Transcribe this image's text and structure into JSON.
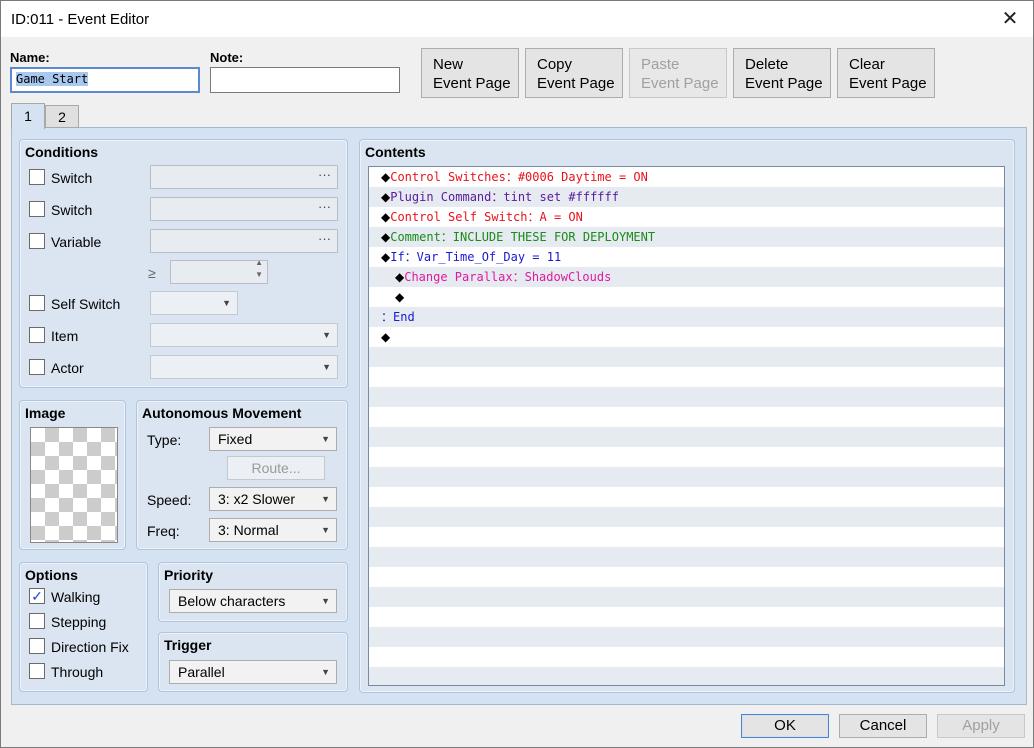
{
  "window": {
    "title": "ID:011 - Event Editor",
    "close_glyph": "✕"
  },
  "header": {
    "name_label": "Name:",
    "name_value": "Game Start",
    "note_label": "Note:",
    "note_value": "",
    "buttons": [
      {
        "line1": "New",
        "line2": "Event Page"
      },
      {
        "line1": "Copy",
        "line2": "Event Page"
      },
      {
        "line1": "Paste",
        "line2": "Event Page"
      },
      {
        "line1": "Delete",
        "line2": "Event Page"
      },
      {
        "line1": "Clear",
        "line2": "Event Page"
      }
    ]
  },
  "tabs": [
    "1",
    "2"
  ],
  "conditions": {
    "title": "Conditions",
    "switch1": "Switch",
    "switch2": "Switch",
    "variable": "Variable",
    "gte": "≥",
    "self_switch": "Self Switch",
    "item": "Item",
    "actor": "Actor",
    "dots": "···"
  },
  "image": {
    "title": "Image"
  },
  "movement": {
    "title": "Autonomous Movement",
    "type_label": "Type:",
    "type_value": "Fixed",
    "route_label": "Route...",
    "speed_label": "Speed:",
    "speed_value": "3: x2 Slower",
    "freq_label": "Freq:",
    "freq_value": "3: Normal"
  },
  "options": {
    "title": "Options",
    "check_glyph": "✓",
    "walking": "Walking",
    "stepping": "Stepping",
    "direction_fix": "Direction Fix",
    "through": "Through"
  },
  "priority": {
    "title": "Priority",
    "value": "Below characters"
  },
  "trigger": {
    "title": "Trigger",
    "value": "Parallel"
  },
  "contents": {
    "title": "Contents",
    "lines": [
      {
        "head": "Control Switches",
        "sep": "：",
        "body": "#0006 Daytime = ON"
      },
      {
        "head": "Plugin Command",
        "sep": "：",
        "body": "tint set #ffffff"
      },
      {
        "head": "Control Self Switch",
        "sep": "：",
        "body": "A = ON"
      },
      {
        "head": "Comment",
        "sep": "：",
        "body": "INCLUDE THESE FOR DEPLOYMENT"
      },
      {
        "head": "If",
        "sep": "：",
        "body": "Var_Time_Of_Day = 11"
      },
      {
        "head": "Change Parallax",
        "sep": "：",
        "body": "ShadowClouds"
      },
      {
        "head": "",
        "sep": "",
        "body": ""
      },
      {
        "head": "",
        "sep": "：",
        "body": "End"
      },
      {
        "head": "",
        "sep": "",
        "body": ""
      }
    ],
    "diamond": "◆"
  },
  "footer": {
    "ok": "OK",
    "cancel": "Cancel",
    "apply": "Apply"
  },
  "colors": {
    "red": "#e8131b",
    "purple": "#5a1a9a",
    "green": "#1a8a1a",
    "blue": "#1a1ad0",
    "magenta": "#e01aa0"
  }
}
